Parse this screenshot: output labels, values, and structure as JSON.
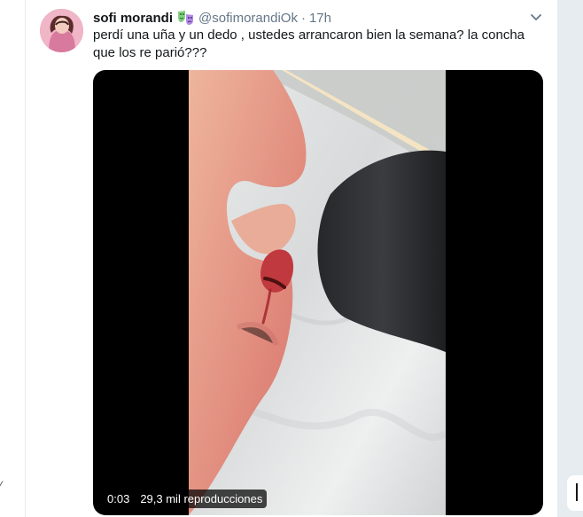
{
  "tweet": {
    "author_name": "sofi morandi",
    "handle": "@sofimorandiOk",
    "separator": "·",
    "time": "17h",
    "text": "perdí una uña y un dedo , ustedes arrancaron bien la semana? la concha que los re parió???",
    "emoji_icon": "theater-masks-icon"
  },
  "media": {
    "elapsed": "0:03",
    "views": "29,3 mil reproducciones"
  },
  "side": {
    "left_mark": "⁄"
  }
}
